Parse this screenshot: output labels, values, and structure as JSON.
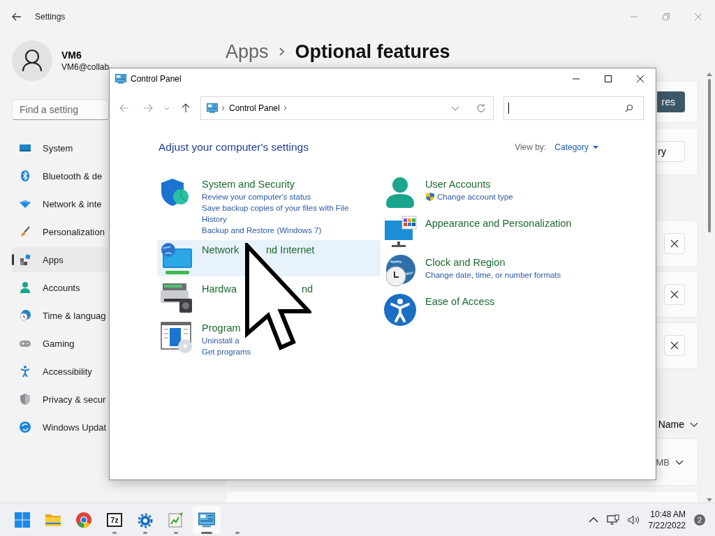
{
  "settings": {
    "title": "Settings",
    "user": {
      "name": "VM6",
      "email": "VM6@collab"
    },
    "search": {
      "placeholder": "Find a setting"
    },
    "nav": [
      {
        "label": "System",
        "kind": "system",
        "selected": false
      },
      {
        "label": "Bluetooth & de",
        "kind": "bluetooth",
        "selected": false
      },
      {
        "label": "Network & inte",
        "kind": "network",
        "selected": false
      },
      {
        "label": "Personalization",
        "kind": "brush",
        "selected": false
      },
      {
        "label": "Apps",
        "kind": "apps",
        "selected": true
      },
      {
        "label": "Accounts",
        "kind": "accounts",
        "selected": false
      },
      {
        "label": "Time & languag",
        "kind": "time",
        "selected": false
      },
      {
        "label": "Gaming",
        "kind": "gaming",
        "selected": false
      },
      {
        "label": "Accessibility",
        "kind": "accessibility",
        "selected": false
      },
      {
        "label": "Privacy & secur",
        "kind": "privacy",
        "selected": false
      },
      {
        "label": "Windows Updat",
        "kind": "update",
        "selected": false
      }
    ],
    "breadcrumb": [
      "Apps",
      "Optional features"
    ],
    "cards": [
      {
        "kind": "primary",
        "label": "res"
      },
      {
        "kind": "button",
        "label": "ry"
      },
      {
        "kind": "remove"
      },
      {
        "kind": "remove"
      },
      {
        "kind": "remove"
      },
      {
        "kind": "sort",
        "label": "Name"
      },
      {
        "kind": "expand",
        "label": "MB"
      },
      {
        "kind": "blank"
      }
    ]
  },
  "control_panel": {
    "title": "Control Panel",
    "address": [
      "Control Panel"
    ],
    "heading": "Adjust your computer's settings",
    "view_by": {
      "label": "View by:",
      "value": "Category"
    },
    "columns": [
      [
        {
          "title": [
            "System and Security"
          ],
          "kind": "security",
          "highlighted": false,
          "links": [
            {
              "text": "Review your computer's status",
              "shield": false
            },
            {
              "text": "Save backup copies of your files with File History",
              "shield": false
            },
            {
              "text": "Backup and Restore (Windows 7)",
              "shield": false
            }
          ]
        },
        {
          "title": [
            "Network",
            "nd Internet"
          ],
          "kind": "network",
          "highlighted": true
        },
        {
          "title": [
            "Hardwa",
            "nd"
          ],
          "kind": "hardware",
          "highlighted": false
        },
        {
          "title": [
            "Program"
          ],
          "kind": "programs",
          "highlighted": false,
          "links": [
            {
              "text": "Uninstall a",
              "shield": false
            },
            {
              "text": "Get programs",
              "shield": false
            }
          ]
        }
      ],
      [
        {
          "title": [
            "User Accounts"
          ],
          "kind": "users",
          "highlighted": false,
          "links": [
            {
              "text": "Change account type",
              "shield": true
            }
          ]
        },
        {
          "title": [
            "Appearance and Personalization"
          ],
          "kind": "appearance",
          "highlighted": false
        },
        {
          "title": [
            "Clock and Region"
          ],
          "kind": "clock",
          "highlighted": false,
          "links": [
            {
              "text": "Change date, time, or number formats",
              "shield": false
            }
          ]
        },
        {
          "title": [
            "Ease of Access"
          ],
          "kind": "access",
          "highlighted": false
        }
      ]
    ]
  },
  "taskbar": {
    "apps": [
      {
        "kind": "start",
        "running": false,
        "active": false
      },
      {
        "kind": "folder",
        "running": false,
        "active": false
      },
      {
        "kind": "browser",
        "running": false,
        "active": false
      },
      {
        "kind": "archiver",
        "label": "7z",
        "running": true,
        "active": false
      },
      {
        "kind": "gear",
        "running": true,
        "active": false
      },
      {
        "kind": "chart",
        "running": true,
        "active": false
      },
      {
        "kind": "panel",
        "running": true,
        "active": true
      },
      {
        "kind": "hidden",
        "running": true,
        "active": false
      }
    ],
    "time": "10:48 AM",
    "date": "7/22/2022",
    "notifications": "2"
  }
}
